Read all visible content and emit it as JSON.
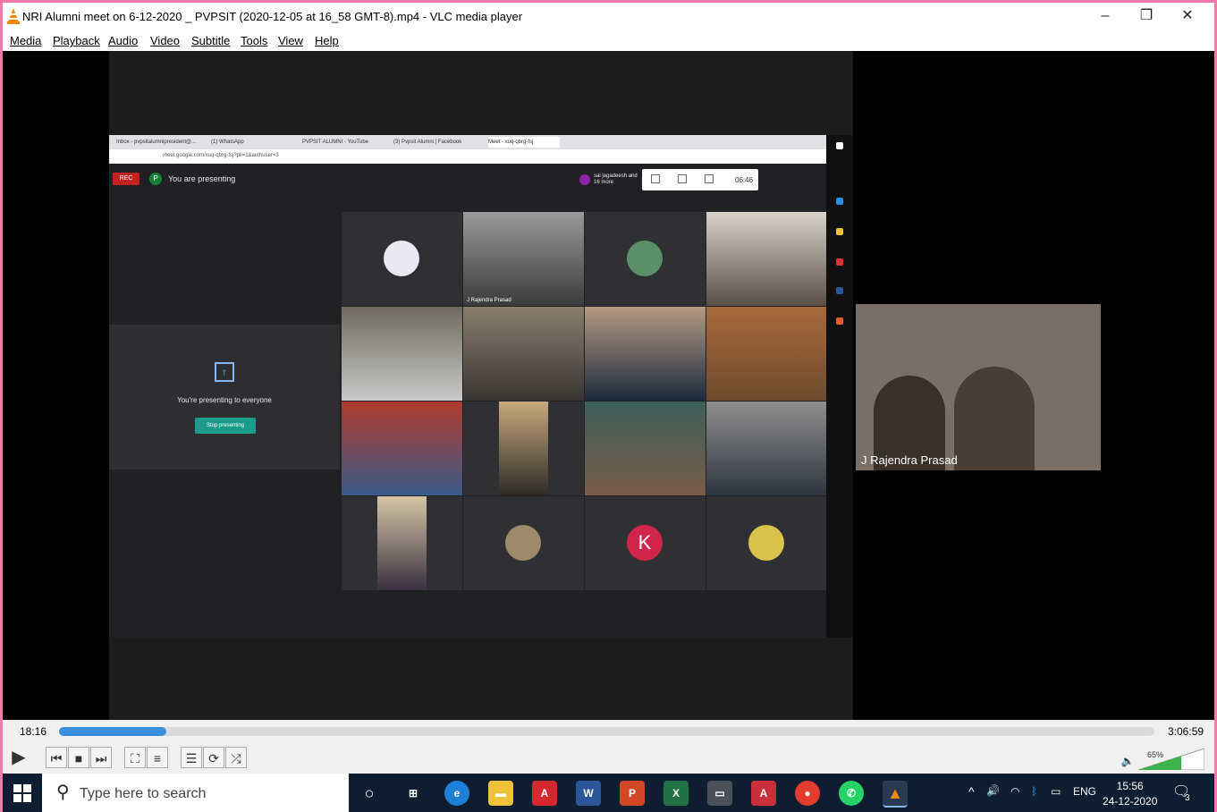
{
  "window": {
    "title": "NRI Alumni meet on 6-12-2020 _ PVPSIT (2020-12-05 at 16_58 GMT-8).mp4 - VLC media player",
    "minimize": "–",
    "restore": "❐",
    "close": "✕"
  },
  "menu": [
    "Media",
    "Playback",
    "Audio",
    "Video",
    "Subtitle",
    "Tools",
    "View",
    "Help"
  ],
  "browser": {
    "tabs": [
      "Inbox - pvpsitalumnipresident@...",
      "(1) WhatsApp",
      "PVPSIT ALUMNI - YouTube",
      "(3) Pvpsit Alumni | Facebook",
      "Meet - xuq-qbrg-fsj"
    ],
    "url": "meet.google.com/xuq-qbrg-fsj?pli=1&authuser=3"
  },
  "meet": {
    "rec": "REC",
    "presenter_initial": "P",
    "presenting_label": "You are presenting",
    "participants_label": "sai jagadeesh and 16 more",
    "meeting_time": "06:46",
    "share_text": "You're presenting to everyone",
    "stop_presenting": "Stop presenting",
    "tile_name": "J Rajendra Prasad",
    "k_avatar": "K"
  },
  "side_video": {
    "name": "J Rajendra Prasad"
  },
  "player": {
    "current_time": "18:16",
    "total_time": "3:06:59",
    "progress": 0.098,
    "volume": "65%"
  },
  "taskbar": {
    "search_placeholder": "Type here to search",
    "lang": "ENG",
    "time": "15:56",
    "date": "24-12-2020",
    "notification_count": "3"
  },
  "colors": {
    "accent": "#3a8fdc",
    "border": "#f47aa9",
    "taskbar": "#0f1d30",
    "meet_bg": "#202124"
  }
}
